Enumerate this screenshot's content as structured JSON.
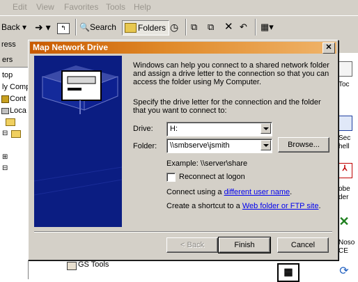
{
  "menu": {
    "edit": "Edit",
    "view": "View",
    "favorites": "Favorites",
    "tools": "Tools",
    "help": "Help"
  },
  "toolbar": {
    "back": "Back",
    "search": "Search",
    "folders": "Folders"
  },
  "address": {
    "label": "ress"
  },
  "left_pane": {
    "header": "ers",
    "items": [
      "top",
      "ly Comp",
      "Cont",
      "Loca"
    ]
  },
  "right_pane": {
    "items": [
      "Toc",
      "Sec",
      "hell",
      "obe",
      "der",
      "Noso",
      "CE"
    ]
  },
  "background": {
    "gs_tools": "GS Tools"
  },
  "dialog": {
    "title": "Map Network Drive",
    "intro": "Windows can help you connect to a shared network folder and assign a drive letter to the connection so that you can access the folder using My Computer.",
    "specify": "Specify the drive letter for the connection and the folder that you want to connect to:",
    "drive_label": "Drive:",
    "drive_value": "H:",
    "folder_label": "Folder:",
    "folder_value": "\\\\smbserve\\jsmith",
    "browse": "Browse...",
    "example": "Example: \\\\server\\share",
    "reconnect": "Reconnect at logon",
    "connect_prefix": "Connect using a ",
    "connect_link": "different user name",
    "connect_suffix": ".",
    "shortcut_prefix": "Create a shortcut to a ",
    "shortcut_link": "Web folder or FTP site",
    "shortcut_suffix": ".",
    "back_btn": "< Back",
    "finish_btn": "Finish",
    "cancel_btn": "Cancel",
    "reconnect_checked": false
  },
  "colors": {
    "title_gradient_start": "#c85a00",
    "art_bg": "#0b1d82",
    "face": "#d4d0c8",
    "link": "#0000ee"
  }
}
